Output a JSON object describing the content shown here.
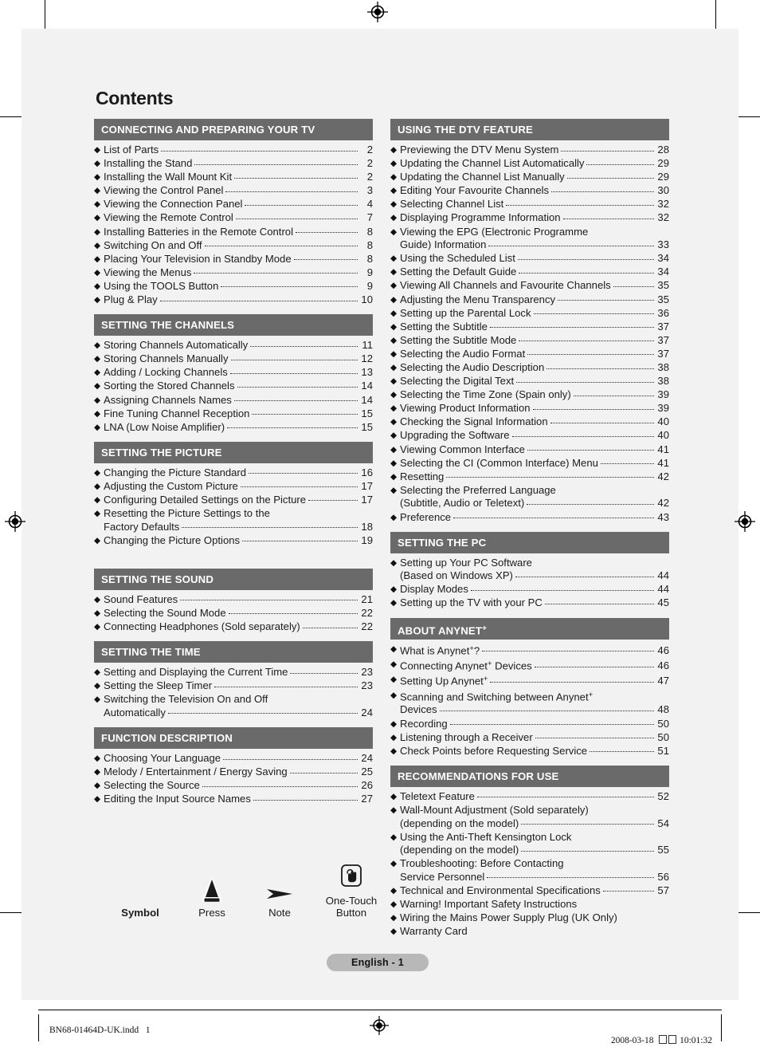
{
  "document": {
    "title": "Contents",
    "page_badge": "English - 1",
    "footer": {
      "filename": "BN68-01464D-UK.indd   1",
      "date": "2008-03-18",
      "time": "10:01:32"
    }
  },
  "left_column": [
    {
      "heading": "CONNECTING AND PREPARING YOUR TV",
      "items": [
        {
          "label": "List of Parts",
          "page": "2"
        },
        {
          "label": "Installing the Stand",
          "page": "2"
        },
        {
          "label": "Installing the Wall Mount Kit",
          "page": "2"
        },
        {
          "label": "Viewing the Control Panel",
          "page": "3"
        },
        {
          "label": "Viewing the Connection Panel",
          "page": "4"
        },
        {
          "label": "Viewing the Remote Control",
          "page": "7"
        },
        {
          "label": "Installing Batteries in the Remote Control",
          "page": "8"
        },
        {
          "label": "Switching On and Off",
          "page": "8"
        },
        {
          "label": "Placing Your Television in Standby Mode",
          "page": "8"
        },
        {
          "label": "Viewing the Menus",
          "page": "9"
        },
        {
          "label": "Using the TOOLS Button",
          "page": "9"
        },
        {
          "label": "Plug & Play",
          "page": "10"
        }
      ]
    },
    {
      "heading": "SETTING THE CHANNELS",
      "items": [
        {
          "label": "Storing Channels Automatically",
          "page": "11"
        },
        {
          "label": "Storing Channels Manually",
          "page": "12"
        },
        {
          "label": "Adding / Locking Channels",
          "page": "13"
        },
        {
          "label": "Sorting the Stored Channels",
          "page": "14"
        },
        {
          "label": "Assigning Channels Names",
          "page": "14"
        },
        {
          "label": "Fine Tuning Channel Reception",
          "page": "15"
        },
        {
          "label": "LNA (Low Noise Amplifier)",
          "page": "15"
        }
      ]
    },
    {
      "heading": "SETTING THE PICTURE",
      "items": [
        {
          "label": "Changing the Picture Standard",
          "page": "16"
        },
        {
          "label": "Adjusting the Custom Picture",
          "page": "17"
        },
        {
          "label": "Configuring Detailed Settings on the Picture",
          "page": "17"
        },
        {
          "label": "Resetting the Picture Settings to the",
          "cont": "Factory Defaults",
          "page": "18"
        },
        {
          "label": "Changing the Picture Options",
          "page": "19"
        }
      ]
    },
    {
      "heading": "SETTING THE SOUND",
      "items": [
        {
          "label": "Sound Features",
          "page": "21"
        },
        {
          "label": "Selecting the Sound Mode",
          "page": "22"
        },
        {
          "label": "Connecting Headphones (Sold separately)",
          "page": "22"
        }
      ]
    },
    {
      "heading": "SETTING THE TIME",
      "items": [
        {
          "label": "Setting and Displaying the Current Time",
          "page": "23"
        },
        {
          "label": "Setting the Sleep Timer",
          "page": "23"
        },
        {
          "label": "Switching the Television On and Off",
          "cont": "Automatically",
          "page": "24"
        }
      ]
    },
    {
      "heading": "FUNCTION DESCRIPTION",
      "items": [
        {
          "label": "Choosing Your Language",
          "page": "24"
        },
        {
          "label": "Melody / Entertainment / Energy Saving",
          "page": "25"
        },
        {
          "label": "Selecting the Source",
          "page": "26"
        },
        {
          "label": "Editing the Input Source Names",
          "page": "27"
        }
      ]
    }
  ],
  "right_column": [
    {
      "heading": "USING THE DTV FEATURE",
      "items": [
        {
          "label": "Previewing the DTV Menu System",
          "page": "28"
        },
        {
          "label": "Updating the Channel List Automatically",
          "page": "29"
        },
        {
          "label": "Updating the Channel List Manually",
          "page": "29"
        },
        {
          "label": "Editing Your Favourite Channels",
          "page": "30"
        },
        {
          "label": "Selecting Channel List",
          "page": "32"
        },
        {
          "label": "Displaying Programme Information",
          "page": "32"
        },
        {
          "label": "Viewing the EPG (Electronic Programme",
          "cont": "Guide) Information",
          "page": "33"
        },
        {
          "label": "Using the Scheduled List",
          "page": "34"
        },
        {
          "label": "Setting the Default Guide",
          "page": "34"
        },
        {
          "label": "Viewing All Channels and Favourite Channels",
          "page": "35"
        },
        {
          "label": "Adjusting the Menu Transparency",
          "page": "35"
        },
        {
          "label": "Setting up the Parental Lock",
          "page": "36"
        },
        {
          "label": "Setting the Subtitle",
          "page": "37"
        },
        {
          "label": "Setting the Subtitle Mode",
          "page": "37"
        },
        {
          "label": "Selecting the Audio Format",
          "page": "37"
        },
        {
          "label": "Selecting the Audio Description",
          "page": "38"
        },
        {
          "label": "Selecting the Digital Text",
          "page": "38"
        },
        {
          "label": "Selecting the Time Zone (Spain only)",
          "page": "39"
        },
        {
          "label": "Viewing Product Information",
          "page": "39"
        },
        {
          "label": "Checking the Signal Information",
          "page": "40"
        },
        {
          "label": "Upgrading the Software",
          "page": "40"
        },
        {
          "label": "Viewing Common Interface",
          "page": "41"
        },
        {
          "label": "Selecting the CI (Common Interface) Menu",
          "page": "41"
        },
        {
          "label": "Resetting",
          "page": "42"
        },
        {
          "label": "Selecting the Preferred Language",
          "cont": "(Subtitle, Audio or Teletext)",
          "page": "42"
        },
        {
          "label": "Preference",
          "page": "43"
        }
      ]
    },
    {
      "heading": "SETTING THE PC",
      "items": [
        {
          "label": "Setting up Your PC Software",
          "cont": "(Based on Windows XP)",
          "page": "44"
        },
        {
          "label": "Display Modes",
          "page": "44"
        },
        {
          "label": "Setting up the TV with your PC",
          "page": "45"
        }
      ]
    },
    {
      "heading": "ABOUT ANYNET",
      "heading_sup": "+",
      "items": [
        {
          "label": "What is Anynet",
          "label_sup": "+",
          "label_tail": "?",
          "page": "46"
        },
        {
          "label": "Connecting Anynet",
          "label_sup": "+",
          "label_tail": " Devices",
          "page": "46"
        },
        {
          "label": "Setting Up Anynet",
          "label_sup": "+",
          "page": "47"
        },
        {
          "label": "Scanning and Switching between Anynet",
          "label_sup": "+",
          "cont": "Devices",
          "page": "48"
        },
        {
          "label": "Recording",
          "page": "50"
        },
        {
          "label": "Listening through a Receiver",
          "page": "50"
        },
        {
          "label": "Check Points before Requesting Service",
          "page": "51"
        }
      ]
    },
    {
      "heading": "RECOMMENDATIONS FOR USE",
      "items": [
        {
          "label": "Teletext Feature",
          "page": "52"
        },
        {
          "label": "Wall-Mount Adjustment (Sold separately)",
          "cont": "(depending on the model)",
          "page": "54"
        },
        {
          "label": "Using the Anti-Theft Kensington Lock",
          "cont": "(depending on the model)",
          "page": "55"
        },
        {
          "label": "Troubleshooting: Before Contacting",
          "cont": "Service Personnel",
          "page": "56"
        },
        {
          "label": "Technical and Environmental Specifications",
          "page": "57"
        },
        {
          "label": "Warning! Important Safety Instructions",
          "page": ""
        },
        {
          "label": "Wiring the Mains Power Supply Plug (UK Only)",
          "page": ""
        },
        {
          "label": "Warranty Card",
          "page": ""
        }
      ]
    }
  ],
  "legend": {
    "symbol_label": "Symbol",
    "entries": [
      {
        "icon": "press-triangle-icon",
        "caption": "Press"
      },
      {
        "icon": "note-arrow-icon",
        "caption": "Note"
      },
      {
        "icon": "one-touch-button-icon",
        "caption": "One-Touch",
        "caption2": "Button"
      }
    ]
  },
  "colors": {
    "section_header_bg": "#6a6a6a",
    "page_badge_bg": "#b8b8b8",
    "page_bg": "#f2f2f2"
  }
}
